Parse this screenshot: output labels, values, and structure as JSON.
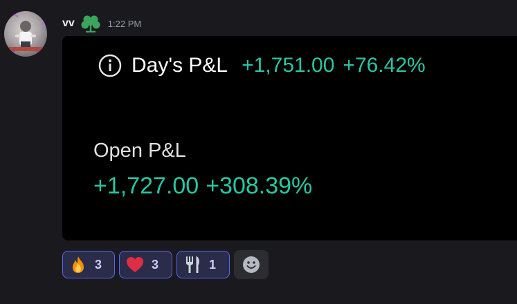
{
  "message": {
    "username": "vv",
    "timestamp": "1:22 PM",
    "role_icon": "clover-icon",
    "colors": {
      "username": "#f2f3f5",
      "timestamp": "#949ba4",
      "role_icon": "#3ba55c"
    }
  },
  "attachment": {
    "day_pl": {
      "label": "Day's P&L",
      "value": "+1,751.00",
      "percent": "+76.42%",
      "icon": "info-icon"
    },
    "open_pl": {
      "label": "Open P&L",
      "value": "+1,727.00",
      "percent": "+308.39%"
    },
    "colors": {
      "background": "#000000",
      "positive": "#27c7a3",
      "label": "#ffffff"
    }
  },
  "reactions": [
    {
      "emoji": "fire",
      "count": "3"
    },
    {
      "emoji": "red-heart",
      "count": "3"
    },
    {
      "emoji": "fork-and-knife",
      "count": "1"
    }
  ],
  "add_reaction": {
    "icon": "smiley-face-icon"
  },
  "theme": {
    "background": "#1a1a1e",
    "reaction_border": "#5865f2",
    "reaction_bg": "#2a2c4a"
  }
}
